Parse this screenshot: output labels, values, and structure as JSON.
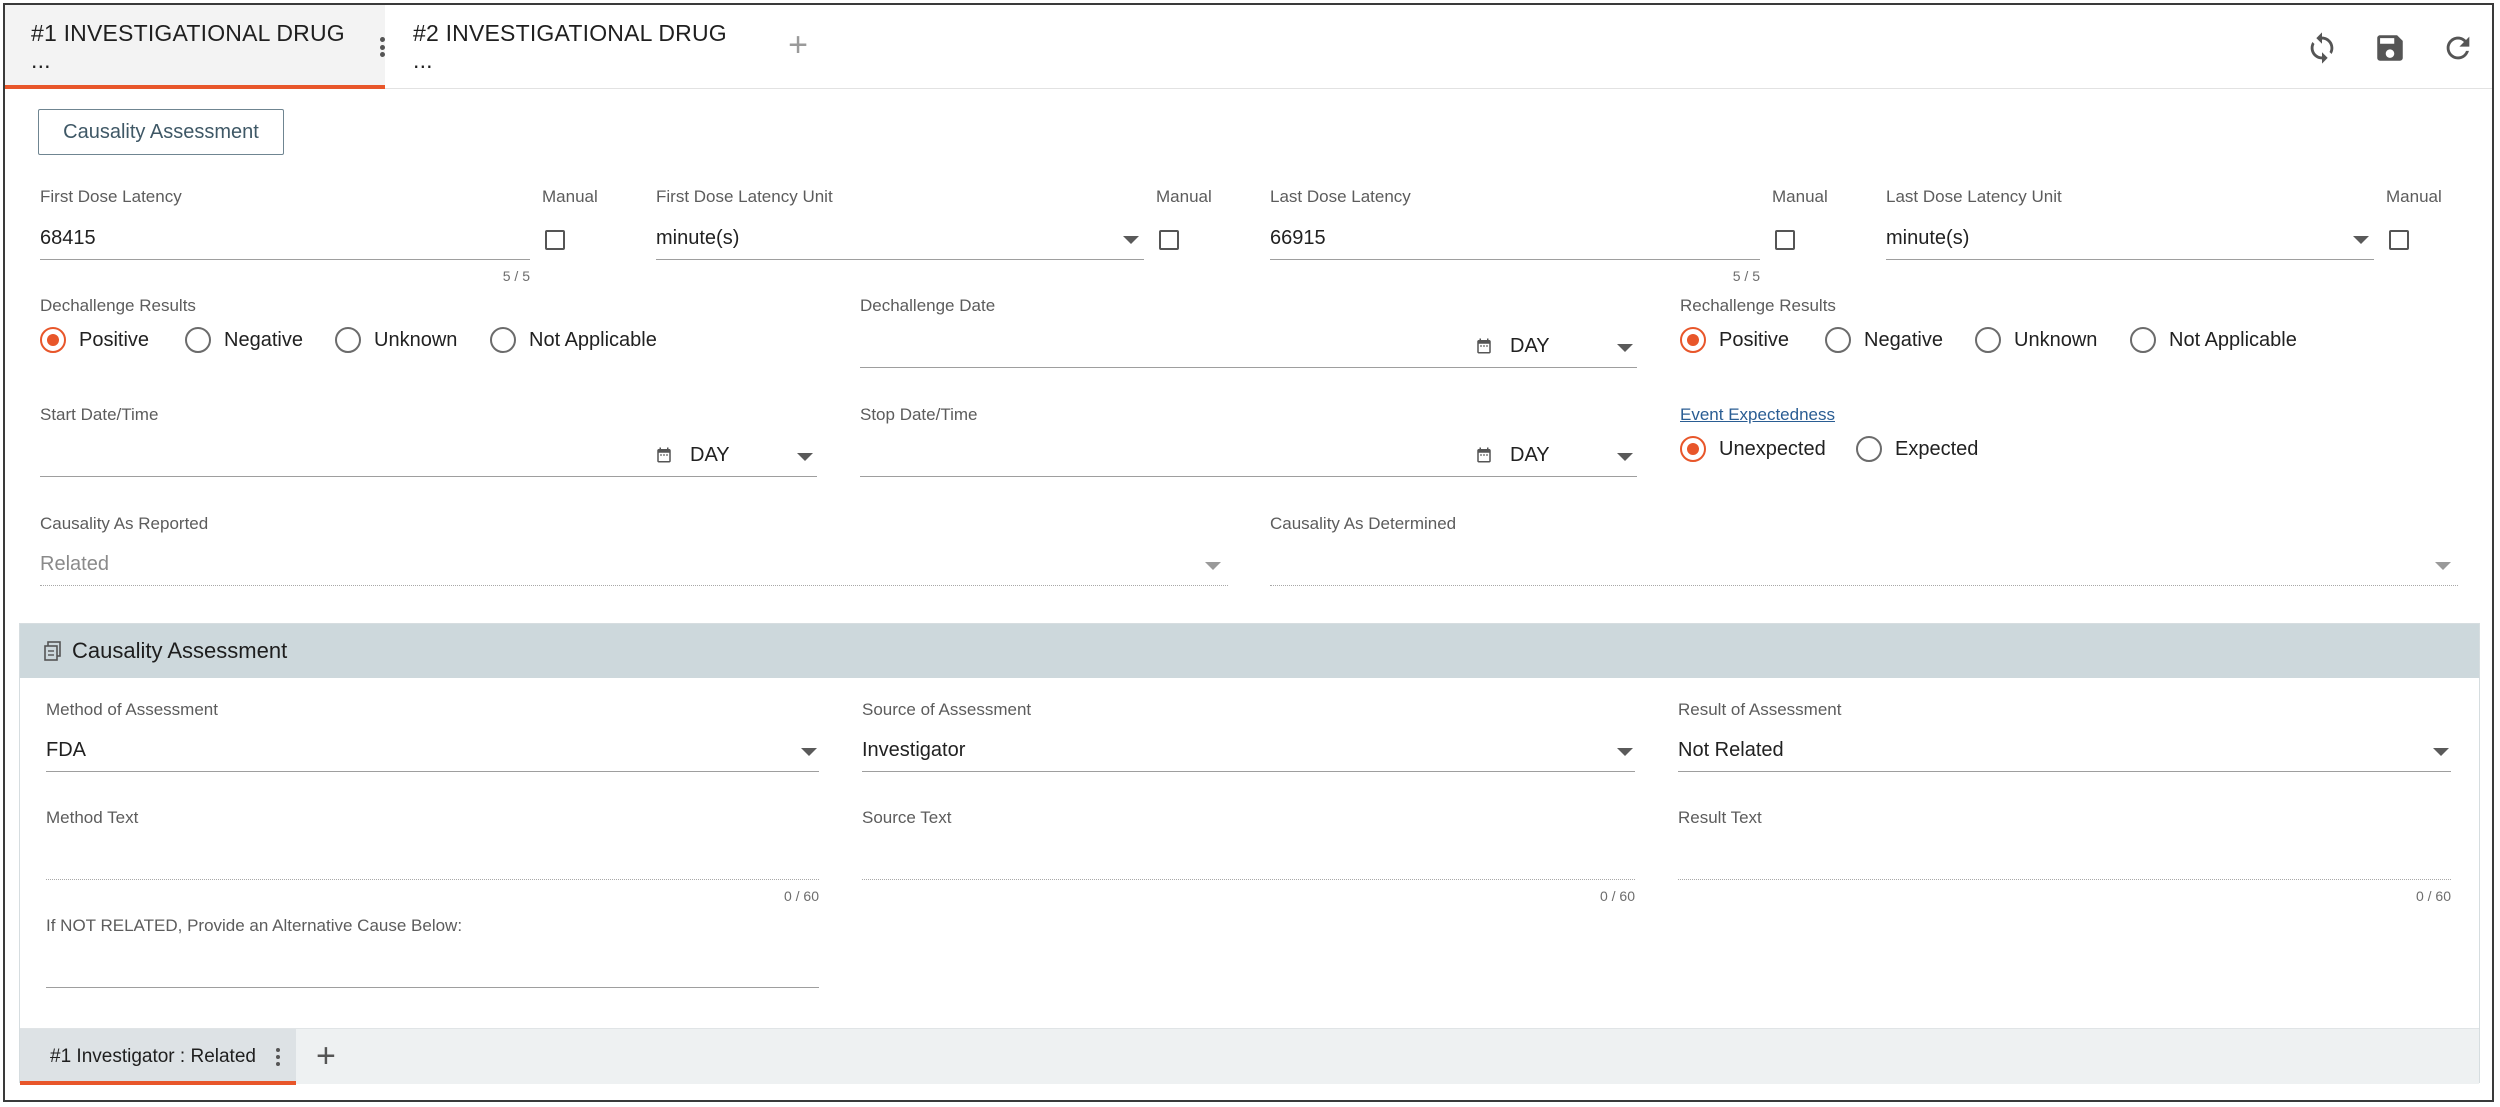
{
  "tabs": [
    {
      "label": "#1 INVESTIGATIONAL DRUG ..."
    },
    {
      "label": "#2 INVESTIGATIONAL DRUG ..."
    }
  ],
  "toolbar": {
    "add_tab_icon": "plus-icon",
    "refresh_icon": "sync-icon",
    "save_icon": "save-icon",
    "reload_icon": "reload-icon"
  },
  "causality_button": "Causality Assessment",
  "first_dose_latency": {
    "label": "First Dose Latency",
    "value": "68415",
    "counter": "5 / 5",
    "manual_label": "Manual"
  },
  "first_dose_latency_unit": {
    "label": "First Dose Latency Unit",
    "value": "minute(s)",
    "manual_label": "Manual"
  },
  "last_dose_latency": {
    "label": "Last Dose Latency",
    "value": "66915",
    "counter": "5 / 5",
    "manual_label": "Manual"
  },
  "last_dose_latency_unit": {
    "label": "Last Dose Latency Unit",
    "value": "minute(s)",
    "manual_label": "Manual"
  },
  "dechallenge_results": {
    "label": "Dechallenge Results",
    "options": [
      "Positive",
      "Negative",
      "Unknown",
      "Not Applicable"
    ],
    "selected": "Positive"
  },
  "dechallenge_date": {
    "label": "Dechallenge Date",
    "precision": "DAY"
  },
  "rechallenge_results": {
    "label": "Rechallenge Results",
    "options": [
      "Positive",
      "Negative",
      "Unknown",
      "Not Applicable"
    ],
    "selected": "Positive"
  },
  "start_datetime": {
    "label": "Start Date/Time",
    "precision": "DAY"
  },
  "stop_datetime": {
    "label": "Stop Date/Time",
    "precision": "DAY"
  },
  "event_expectedness": {
    "label": "Event Expectedness",
    "options": [
      "Unexpected",
      "Expected"
    ],
    "selected": "Unexpected"
  },
  "causality_reported": {
    "label": "Causality As Reported",
    "value": "Related"
  },
  "causality_determined": {
    "label": "Causality As Determined",
    "value": ""
  },
  "assessment_section": {
    "title": "Causality Assessment",
    "method": {
      "label": "Method of Assessment",
      "value": "FDA"
    },
    "source": {
      "label": "Source of Assessment",
      "value": "Investigator"
    },
    "result": {
      "label": "Result of Assessment",
      "value": "Not Related"
    },
    "method_text": {
      "label": "Method Text",
      "counter": "0 / 60"
    },
    "source_text": {
      "label": "Source Text",
      "counter": "0 / 60"
    },
    "result_text": {
      "label": "Result Text",
      "counter": "0 / 60"
    },
    "alt_cause": {
      "label": "If NOT RELATED, Provide an Alternative Cause Below:"
    },
    "subtabs": [
      {
        "label": "#1 Investigator : Related"
      }
    ]
  },
  "colors": {
    "accent": "#e8562a",
    "section_header": "#cdd8dc",
    "link": "#2a5d93"
  }
}
